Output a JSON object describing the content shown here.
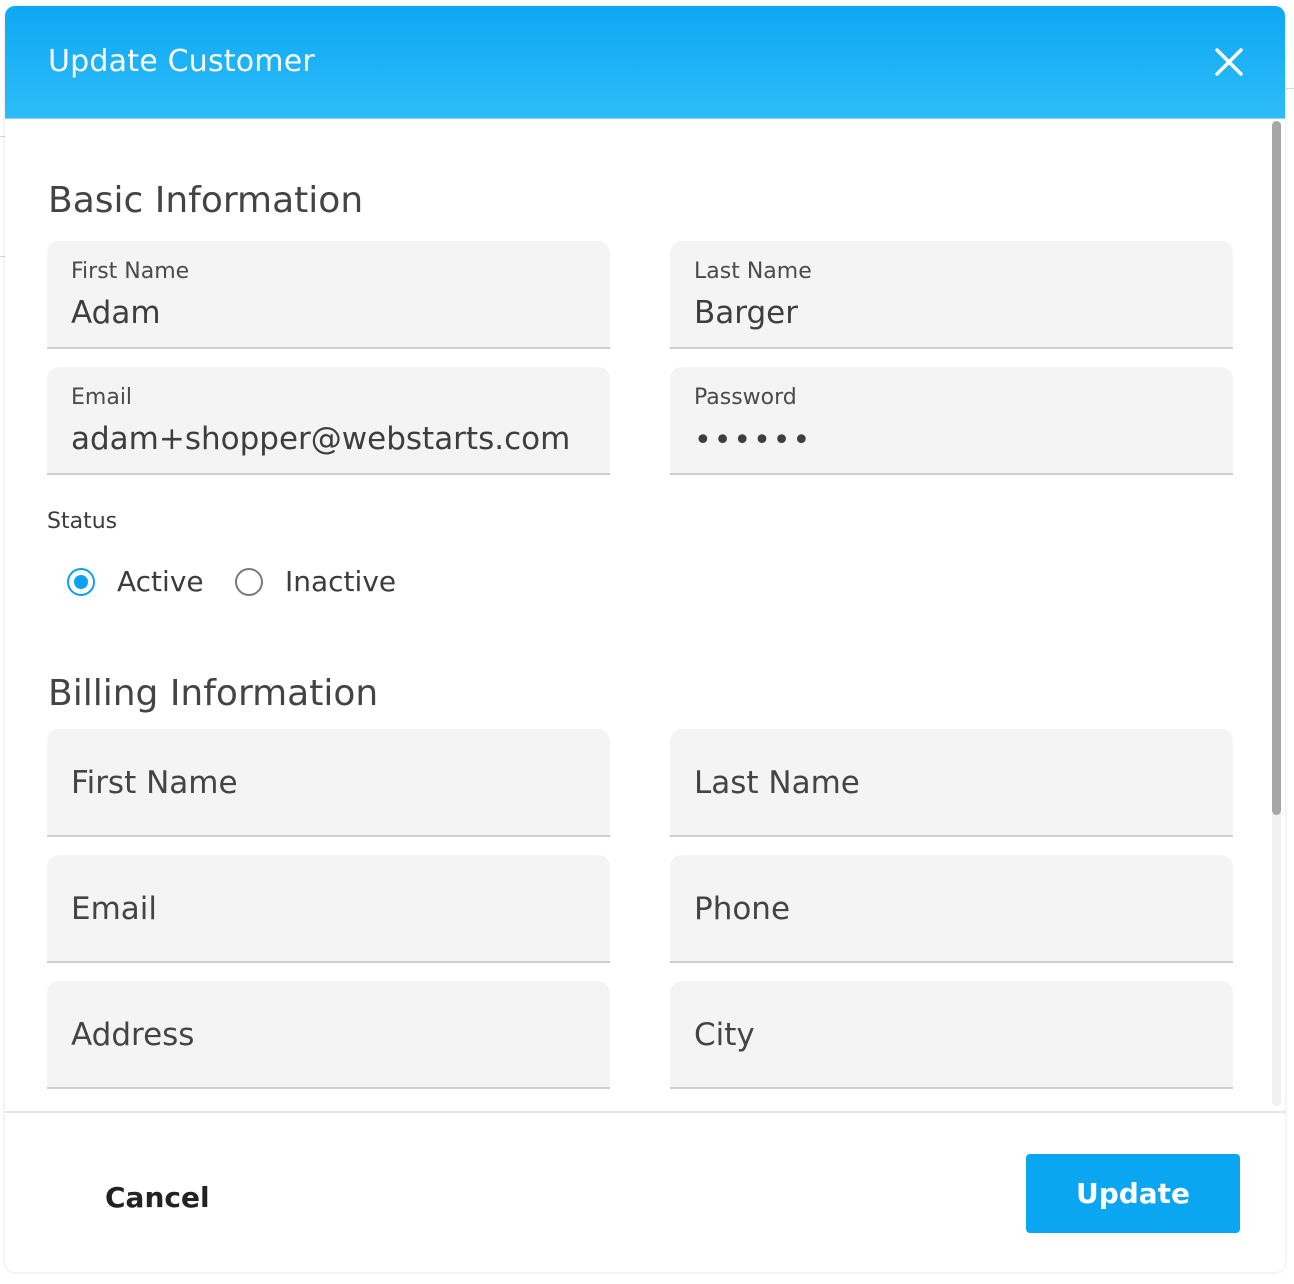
{
  "modal": {
    "title": "Update Customer"
  },
  "basic": {
    "heading": "Basic Information",
    "first_name": {
      "label": "First Name",
      "value": "Adam"
    },
    "last_name": {
      "label": "Last Name",
      "value": "Barger"
    },
    "email": {
      "label": "Email",
      "value": "adam+shopper@webstarts.com"
    },
    "password": {
      "label": "Password",
      "value": "••••••"
    },
    "status": {
      "label": "Status",
      "options": [
        "Active",
        "Inactive"
      ],
      "selected": "Active"
    }
  },
  "billing": {
    "heading": "Billing Information",
    "first_name": {
      "placeholder": "First Name"
    },
    "last_name": {
      "placeholder": "Last Name"
    },
    "email": {
      "placeholder": "Email"
    },
    "phone": {
      "placeholder": "Phone"
    },
    "address": {
      "placeholder": "Address"
    },
    "city": {
      "placeholder": "City"
    }
  },
  "footer": {
    "cancel_label": "Cancel",
    "update_label": "Update"
  },
  "colors": {
    "accent": "#0aa6f2",
    "header_gradient_top": "#0ea8f3",
    "header_gradient_bottom": "#2dbcf9",
    "field_background": "#f4f4f4"
  }
}
